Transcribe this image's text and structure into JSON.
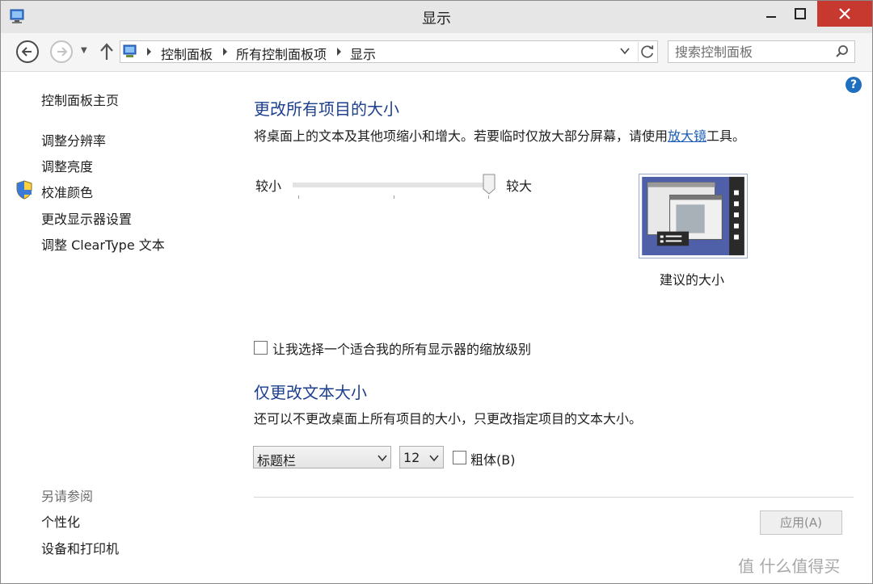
{
  "window": {
    "title": "显示"
  },
  "navigation": {
    "breadcrumb": [
      "控制面板",
      "所有控制面板项",
      "显示"
    ],
    "search_placeholder": "搜索控制面板"
  },
  "sidebar": {
    "home": "控制面板主页",
    "items": [
      "调整分辨率",
      "调整亮度",
      "校准颜色",
      "更改显示器设置",
      "调整 ClearType 文本"
    ],
    "see_also_title": "另请参阅",
    "see_also": [
      "个性化",
      "设备和打印机"
    ]
  },
  "main": {
    "section1": {
      "heading": "更改所有项目的大小",
      "desc_before": "将桌面上的文本及其他项缩小和增大。若要临时仅放大部分屏幕，请使用",
      "desc_link": "放大镜",
      "desc_after": "工具。",
      "slider_min_label": "较小",
      "slider_max_label": "较大",
      "slider_level": 1.0,
      "preview_caption": "建议的大小",
      "checkbox_label": "让我选择一个适合我的所有显示器的缩放级别",
      "checkbox_checked": false
    },
    "section2": {
      "heading": "仅更改文本大小",
      "desc": "还可以不更改桌面上所有项目的大小，只更改指定项目的文本大小。",
      "item_select": "标题栏",
      "size_select": "12",
      "bold_label": "粗体(B)",
      "bold_checked": false
    },
    "apply_button": "应用(A)"
  },
  "watermark": "值 什么值得买",
  "colors": {
    "heading": "#1d3f8f",
    "link": "#1a5cb5",
    "close_button": "#c7382f"
  }
}
